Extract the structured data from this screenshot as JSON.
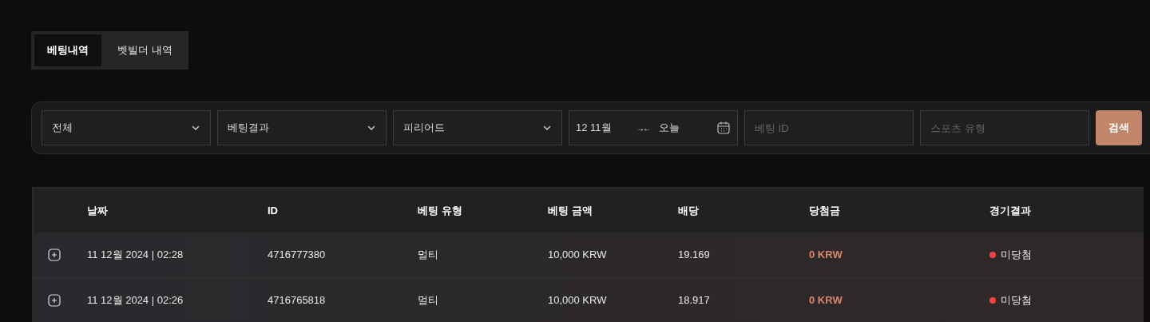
{
  "tabs": [
    {
      "label": "베팅내역",
      "selected": true
    },
    {
      "label": "벳빌더 내역",
      "selected": false
    }
  ],
  "filters": {
    "dropdowns": [
      {
        "value": "전체"
      },
      {
        "value": "베팅결과"
      },
      {
        "value": "피리어드"
      }
    ],
    "date_range": {
      "from": "12 11월",
      "separator": "→←",
      "to": "오늘"
    },
    "fields": [
      {
        "placeholder": "베팅 ID"
      },
      {
        "placeholder": "스포츠 유형"
      }
    ],
    "search_button": "검색"
  },
  "table": {
    "columns": [
      "날짜",
      "ID",
      "베팅 유형",
      "베팅 금액",
      "배당",
      "당첨금",
      "경기결과"
    ],
    "rows": [
      {
        "date": "11 12월 2024 | 02:28",
        "id": "4716777380",
        "type": "멀티",
        "amount": "10,000 KRW",
        "odds": "19.169",
        "winnings": "0 KRW",
        "result": "미당첨",
        "color": "#ef4444"
      },
      {
        "date": "11 12월 2024 | 02:26",
        "id": "4716765818",
        "type": "멀티",
        "amount": "10,000 KRW",
        "odds": "18.917",
        "winnings": "0 KRW",
        "result": "미당첨",
        "color": "#ef4444"
      }
    ]
  }
}
